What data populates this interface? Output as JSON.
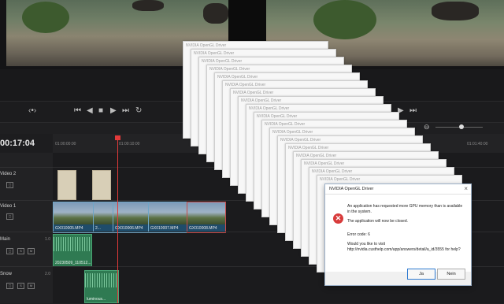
{
  "timeline": {
    "timecode": "00:17:04",
    "ruler_labels": [
      "01:00:00:00",
      "01:00:10:00",
      "01:01:40:00"
    ]
  },
  "tracks": [
    {
      "name": "Video 2"
    },
    {
      "name": "Video 1"
    },
    {
      "name": "Main",
      "number": "1.0"
    },
    {
      "name": "Snow",
      "number": "2.0"
    }
  ],
  "video_clips": [
    "GX010005.MP4",
    "2...",
    "GX010006.MP4",
    "GX010007.MP4",
    "GX010008.MP4"
  ],
  "audio_clips": [
    "20230509_110512...",
    "luminous..."
  ],
  "track_buttons": {
    "solo": "S",
    "mute": "M"
  },
  "error_window_title": "NVIDIA OpenGL Driver",
  "dialog": {
    "title": "NVIDIA OpenGL Driver",
    "message": "An application has requested more GPU memory than is available in the system.",
    "message2": "The application will now be closed.",
    "error_code": "Error code: 6",
    "question": "Would you like to visit http://nvidia.custhelp.com/app/answers/detail/a_id/3555 for help?",
    "yes_label": "Ja",
    "no_label": "Nein"
  },
  "colors": {
    "playhead": "#e23a3a",
    "error_icon": "#d83b3b",
    "video_clip": "#1f4c6a",
    "audio_clip": "#2f7a52"
  }
}
